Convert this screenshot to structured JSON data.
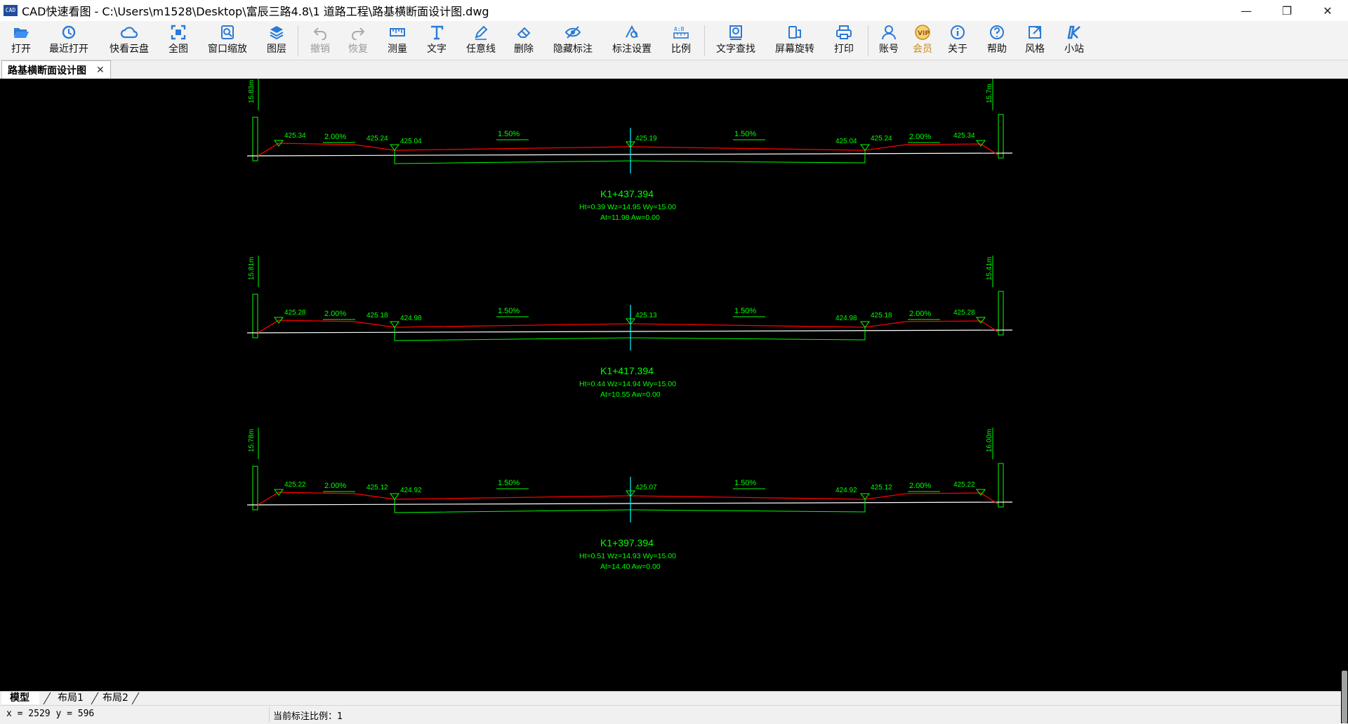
{
  "titlebar": {
    "app_icon_text": "CAD",
    "title": "CAD快速看图 - C:\\Users\\m1528\\Desktop\\富辰三路4.8\\1 道路工程\\路基横断面设计图.dwg",
    "minimize": "—",
    "restore": "❐",
    "close": "✕"
  },
  "toolbar": {
    "items": [
      {
        "label": "打开",
        "icon": "folder-open-icon"
      },
      {
        "label": "最近打开",
        "icon": "history-icon"
      },
      {
        "label": "快看云盘",
        "icon": "cloud-icon"
      },
      {
        "label": "全图",
        "icon": "fit-view-icon"
      },
      {
        "label": "窗口缩放",
        "icon": "zoom-window-icon"
      },
      {
        "label": "图层",
        "icon": "layers-icon"
      },
      {
        "label": "撤销",
        "icon": "undo-icon"
      },
      {
        "label": "恢复",
        "icon": "redo-icon"
      },
      {
        "label": "测量",
        "icon": "measure-icon"
      },
      {
        "label": "文字",
        "icon": "text-icon"
      },
      {
        "label": "任意线",
        "icon": "pen-icon"
      },
      {
        "label": "删除",
        "icon": "eraser-icon"
      },
      {
        "label": "隐藏标注",
        "icon": "eye-hide-icon"
      },
      {
        "label": "标注设置",
        "icon": "annotation-settings-icon"
      },
      {
        "label": "比例",
        "icon": "scale-icon"
      },
      {
        "label": "文字查找",
        "icon": "text-search-icon"
      },
      {
        "label": "屏幕旋转",
        "icon": "rotate-screen-icon"
      },
      {
        "label": "打印",
        "icon": "printer-icon"
      },
      {
        "label": "账号",
        "icon": "user-icon"
      },
      {
        "label": "会员",
        "icon": "vip-icon"
      },
      {
        "label": "关于",
        "icon": "info-icon"
      },
      {
        "label": "帮助",
        "icon": "help-icon"
      },
      {
        "label": "风格",
        "icon": "style-icon"
      },
      {
        "label": "小站",
        "icon": "site-icon"
      }
    ]
  },
  "doc_tab": {
    "label": "路基横断面设计图",
    "close": "✕"
  },
  "drawing": {
    "sections": [
      {
        "station": "K1+437.394",
        "params1": "Ht=0.39  Wz=14.95  Wy=15.00",
        "params2": "At=11.98  Aw=0.00",
        "left_width": "15.83m",
        "right_width": "15.7m",
        "slope_left_outer": "2.00%",
        "slope_left_inner": "1.50%",
        "slope_right_inner": "1.50%",
        "slope_right_outer": "2.00%",
        "elev": [
          "425.34",
          "425.24",
          "425.04",
          "425.19",
          "425.04",
          "425.24",
          "425.34"
        ]
      },
      {
        "station": "K1+417.394",
        "params1": "Ht=0.44  Wz=14.94  Wy=15.00",
        "params2": "At=10.55  Aw=0.00",
        "left_width": "15.81m",
        "right_width": "15.41m",
        "slope_left_outer": "2.00%",
        "slope_left_inner": "1.50%",
        "slope_right_inner": "1.50%",
        "slope_right_outer": "2.00%",
        "elev": [
          "425.28",
          "425.18",
          "424.98",
          "425.13",
          "424.98",
          "425.18",
          "425.28"
        ]
      },
      {
        "station": "K1+397.394",
        "params1": "Ht=0.51  Wz=14.93  Wy=15.00",
        "params2": "At=14.40  Aw=0.00",
        "left_width": "15.78m",
        "right_width": "16.00m",
        "slope_left_outer": "2.00%",
        "slope_left_inner": "1.50%",
        "slope_right_inner": "1.50%",
        "slope_right_outer": "2.00%",
        "elev": [
          "425.22",
          "425.12",
          "424.92",
          "425.07",
          "424.92",
          "425.12",
          "425.22"
        ]
      }
    ],
    "colors": {
      "design_line": "#ff0000",
      "ground_line": "#ffffff",
      "annotation": "#00ff00",
      "centerline": "#00ffff",
      "background": "#000000"
    }
  },
  "layout_tabs": [
    {
      "label": "模型",
      "active": true
    },
    {
      "label": "布局1",
      "active": false
    },
    {
      "label": "布局2",
      "active": false
    }
  ],
  "status": {
    "coords": "x = 2529  y = 596",
    "scale": "当前标注比例：1"
  }
}
